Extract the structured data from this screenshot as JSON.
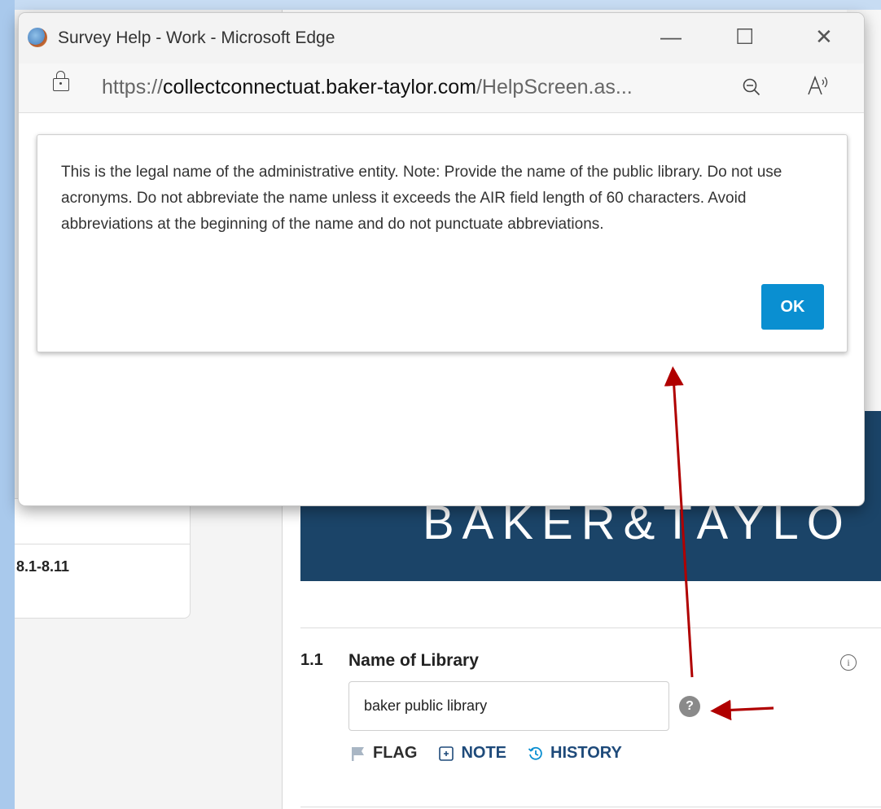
{
  "popup": {
    "window_title": "Survey Help - Work - Microsoft Edge",
    "controls": {
      "minimize": "—",
      "maximize": "☐",
      "close": "✕"
    },
    "url": {
      "protocol": "https://",
      "host": "collectconnectuat.baker-taylor.com",
      "path": "/HelpScreen.as..."
    },
    "dialog": {
      "message": "This is the legal name of the administrative entity. Note: Provide the name of the public library. Do not use acronyms. Do not abbreviate the name unless it exceeds the AIR field length of 60 characters. Avoid abbreviations at the beginning of the name and do not punctuate abbreviations.",
      "ok_label": "OK"
    }
  },
  "sidebar": {
    "section_label": "8.1-8.11"
  },
  "banner": {
    "brand_text": "BAKER&TAYLO"
  },
  "question": {
    "number": "1.1",
    "title": "Name of Library",
    "value": "baker public library",
    "help_label": "?",
    "info_label": "i",
    "actions": {
      "flag": "FLAG",
      "note": "NOTE",
      "history": "HISTORY"
    }
  },
  "icons": {
    "app": "edge-app-icon",
    "lock": "lock-icon",
    "zoom": "zoom-out-icon",
    "read_aloud": "read-aloud-icon",
    "flag": "flag-icon",
    "note": "note-icon",
    "history": "history-icon"
  },
  "colors": {
    "ok_button": "#0a8fd1",
    "banner": "#1b4468",
    "link": "#1e4a7a",
    "annotation_arrow": "#b00000"
  }
}
